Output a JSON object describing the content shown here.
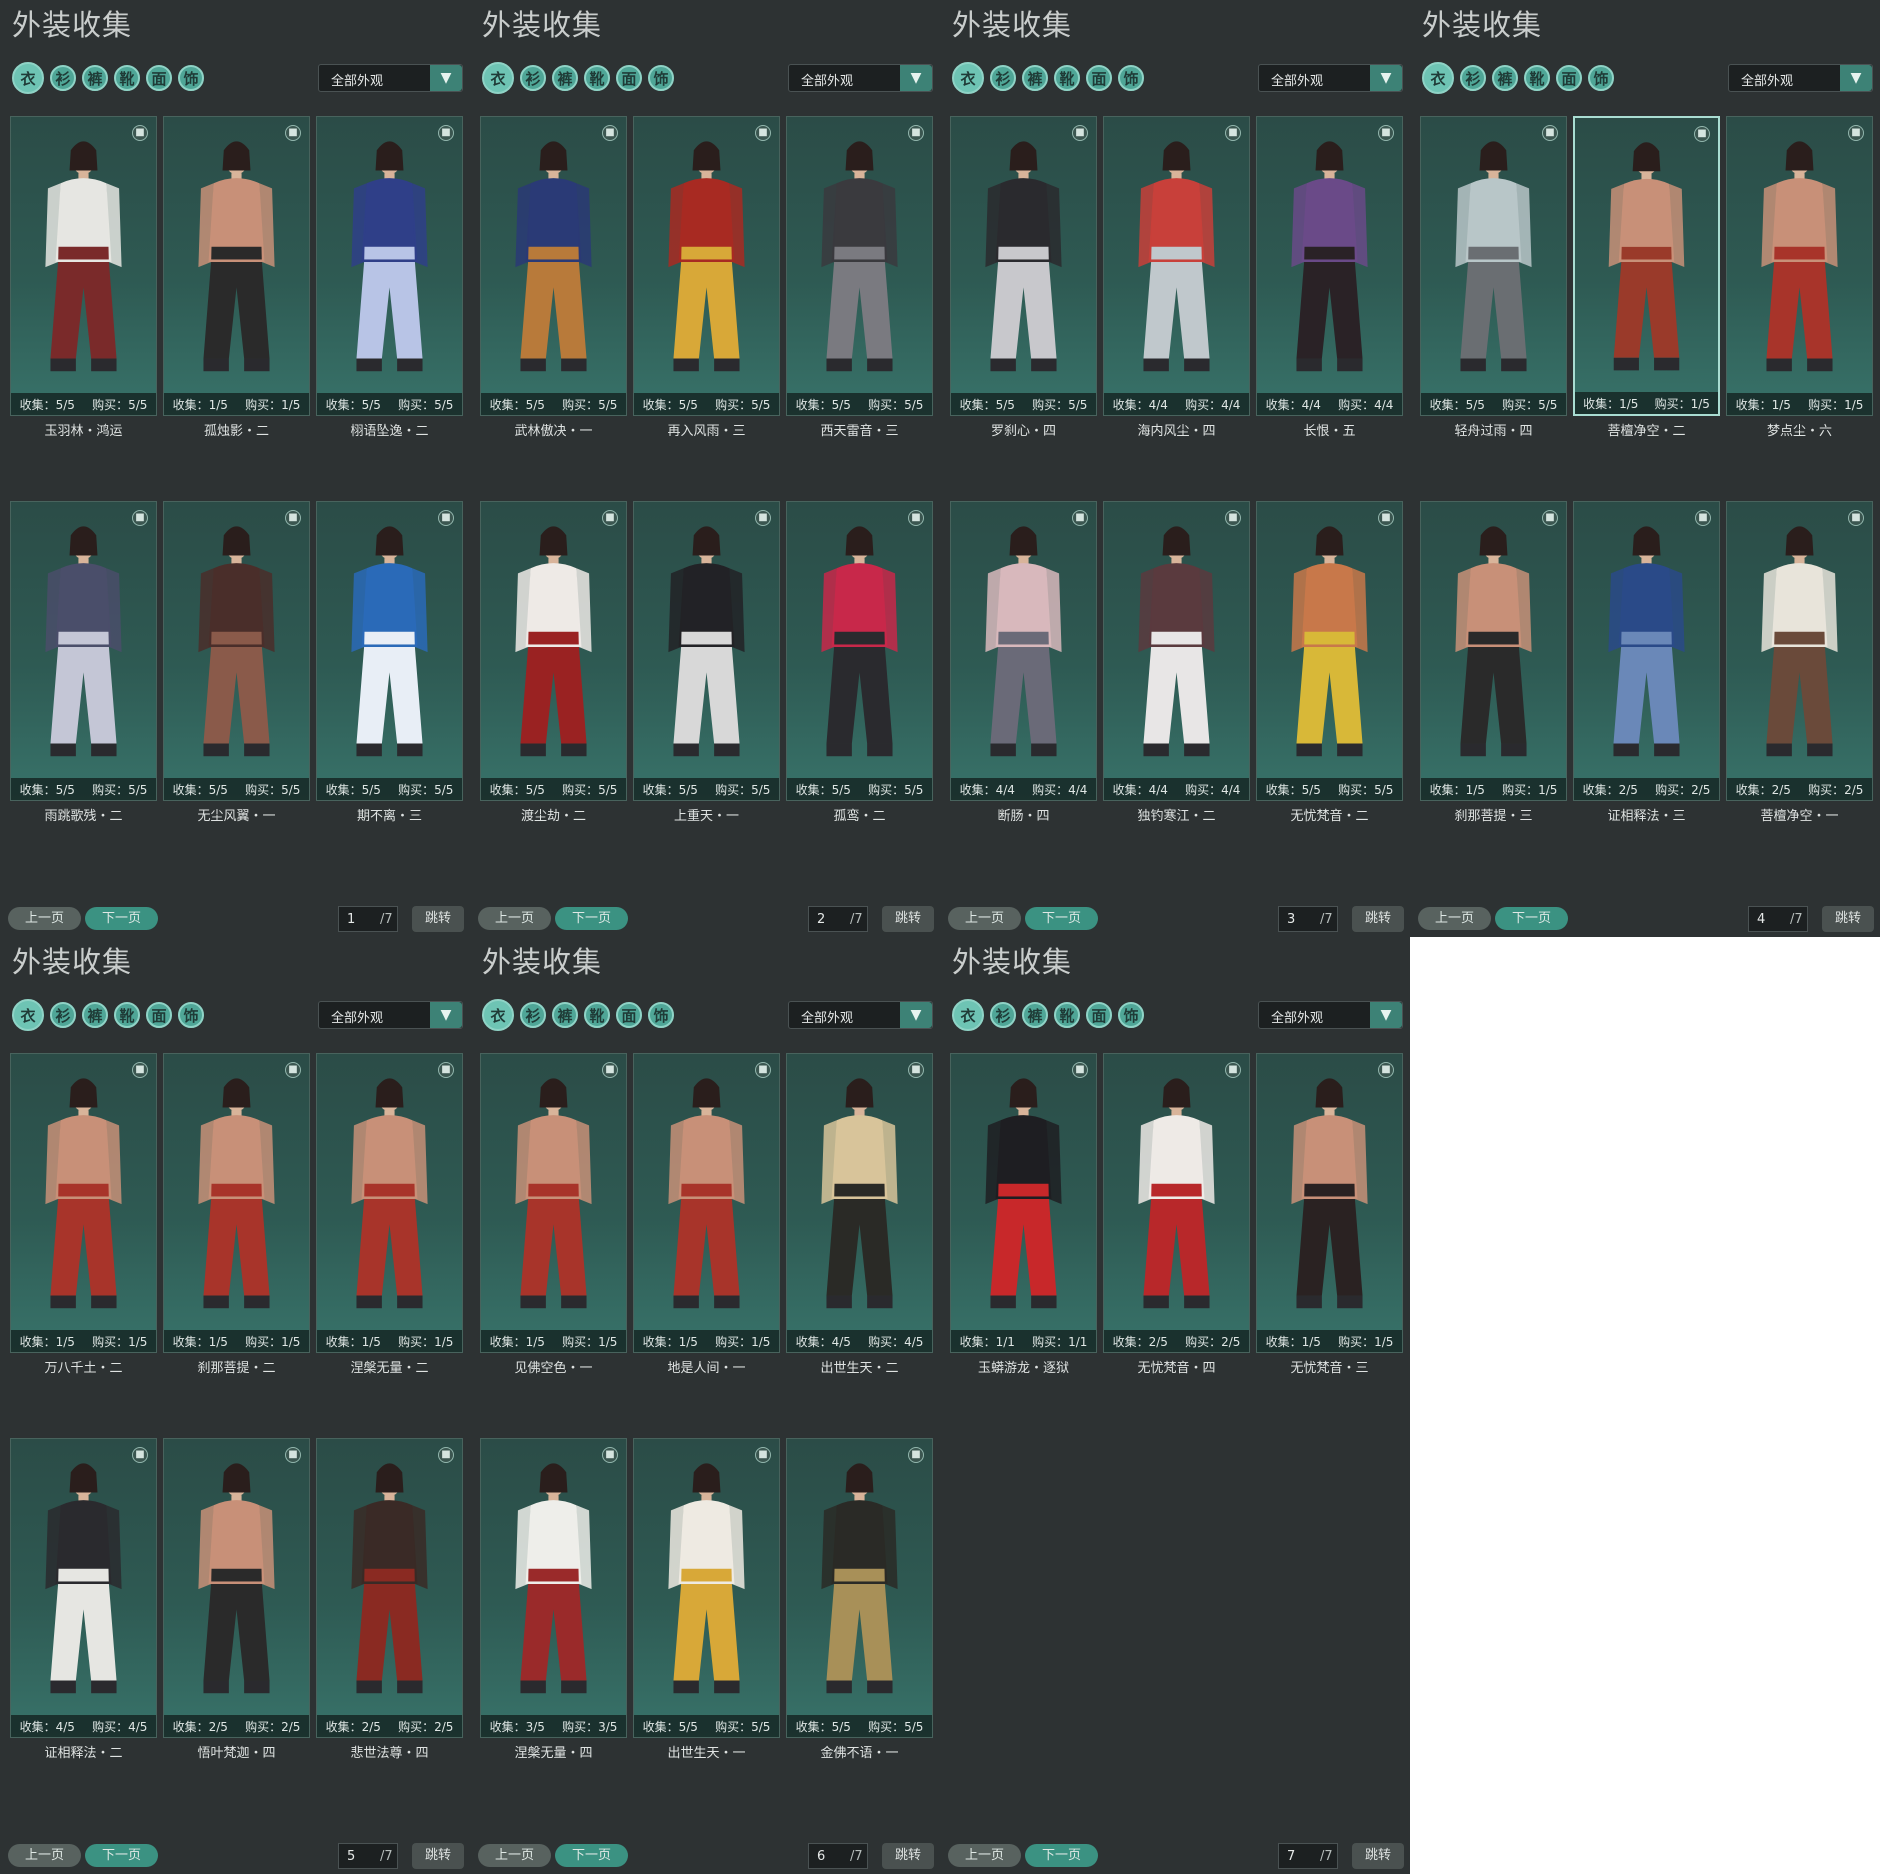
{
  "title": "外装收集",
  "filter_label": "全部外观",
  "prev_label": "上一页",
  "next_label": "下一页",
  "jump_label": "跳转",
  "collect_label": "收集",
  "buy_label": "购买",
  "colors": {
    "panel_bg": "#2d3233",
    "accent": "#3b9282",
    "card_top": "#2b4c47",
    "card_bottom": "#38736a"
  },
  "category_icons": [
    "all-outfits-icon",
    "top-icon",
    "bottom-icon",
    "shoes-icon",
    "mask-icon",
    "accessory-icon"
  ],
  "pages": [
    {
      "current": "1",
      "total": "/7",
      "items": [
        {
          "name": "玉羽林・鸿运",
          "collect": "5/5",
          "buy": "5/5",
          "colors": [
            "#e6e6e2",
            "#7a2a2a"
          ]
        },
        {
          "name": "孤烛影・二",
          "collect": "1/5",
          "buy": "1/5",
          "colors": [
            "#c89078",
            "#2a2a2a"
          ]
        },
        {
          "name": "栩语坠逸・二",
          "collect": "5/5",
          "buy": "5/5",
          "colors": [
            "#2f3f88",
            "#b8c4e6"
          ]
        },
        {
          "name": "雨跳歌残・二",
          "collect": "5/5",
          "buy": "5/5",
          "colors": [
            "#4a4e6a",
            "#c4c6d6"
          ]
        },
        {
          "name": "无尘风翼・一",
          "collect": "5/5",
          "buy": "5/5",
          "colors": [
            "#4a2e2a",
            "#8a5a4a"
          ]
        },
        {
          "name": "期不离・三",
          "collect": "5/5",
          "buy": "5/5",
          "colors": [
            "#2a6ab8",
            "#e8eef6"
          ]
        }
      ]
    },
    {
      "current": "2",
      "total": "/7",
      "items": [
        {
          "name": "武林傲决・一",
          "collect": "5/5",
          "buy": "5/5",
          "colors": [
            "#2a3a76",
            "#b87a3a"
          ]
        },
        {
          "name": "再入风雨・三",
          "collect": "5/5",
          "buy": "5/5",
          "colors": [
            "#a82a22",
            "#d8a838"
          ]
        },
        {
          "name": "西天雷音・三",
          "collect": "5/5",
          "buy": "5/5",
          "colors": [
            "#3a3a3e",
            "#7a7a80"
          ]
        },
        {
          "name": "渡尘劫・二",
          "collect": "5/5",
          "buy": "5/5",
          "colors": [
            "#eeeae6",
            "#9a2222"
          ]
        },
        {
          "name": "上重天・一",
          "collect": "5/5",
          "buy": "5/5",
          "colors": [
            "#222226",
            "#d8d8d8"
          ]
        },
        {
          "name": "孤鸾・二",
          "collect": "5/5",
          "buy": "5/5",
          "colors": [
            "#c8284a",
            "#2a2a2e"
          ]
        }
      ]
    },
    {
      "current": "3",
      "total": "/7",
      "items": [
        {
          "name": "罗刹心・四",
          "collect": "5/5",
          "buy": "5/5",
          "colors": [
            "#2a2a2e",
            "#c8c8cc"
          ]
        },
        {
          "name": "海内风尘・四",
          "collect": "4/4",
          "buy": "4/4",
          "colors": [
            "#c8403a",
            "#c0c8cc"
          ]
        },
        {
          "name": "长恨・五",
          "collect": "4/4",
          "buy": "4/4",
          "colors": [
            "#6a4a88",
            "#2a2226"
          ]
        },
        {
          "name": "断肠・四",
          "collect": "4/4",
          "buy": "4/4",
          "colors": [
            "#d8b8bc",
            "#6a6a78"
          ]
        },
        {
          "name": "独钓寒江・二",
          "collect": "4/4",
          "buy": "4/4",
          "colors": [
            "#5a3a3e",
            "#e8e6e6"
          ]
        },
        {
          "name": "无忧梵音・二",
          "collect": "5/5",
          "buy": "5/5",
          "colors": [
            "#c8784a",
            "#d8b838"
          ]
        }
      ]
    },
    {
      "current": "4",
      "total": "/7",
      "items": [
        {
          "name": "轻舟过雨・四",
          "collect": "5/5",
          "buy": "5/5",
          "colors": [
            "#b8c6c8",
            "#6a6e72"
          ],
          "selected": false
        },
        {
          "name": "菩檀净空・二",
          "collect": "1/5",
          "buy": "1/5",
          "colors": [
            "#c89078",
            "#9a3a2a"
          ],
          "selected": true
        },
        {
          "name": "梦点尘・六",
          "collect": "1/5",
          "buy": "1/5",
          "colors": [
            "#c89078",
            "#a8342a"
          ],
          "selected": false
        },
        {
          "name": "刹那菩提・三",
          "collect": "1/5",
          "buy": "1/5",
          "colors": [
            "#c89078",
            "#2a2a2a"
          ]
        },
        {
          "name": "证相释法・三",
          "collect": "2/5",
          "buy": "2/5",
          "colors": [
            "#2a4a88",
            "#6a88b8"
          ]
        },
        {
          "name": "菩檀净空・一",
          "collect": "2/5",
          "buy": "2/5",
          "colors": [
            "#e8e4da",
            "#6a4a3a"
          ]
        }
      ]
    },
    {
      "current": "5",
      "total": "/7",
      "items": [
        {
          "name": "万八千土・二",
          "collect": "1/5",
          "buy": "1/5",
          "colors": [
            "#c89078",
            "#a8342a"
          ]
        },
        {
          "name": "刹那菩提・二",
          "collect": "1/5",
          "buy": "1/5",
          "colors": [
            "#c89078",
            "#a8342a"
          ]
        },
        {
          "name": "涅槃无量・二",
          "collect": "1/5",
          "buy": "1/5",
          "colors": [
            "#c89078",
            "#a8342a"
          ]
        },
        {
          "name": "证相释法・二",
          "collect": "4/5",
          "buy": "4/5",
          "colors": [
            "#2a2a2e",
            "#e6e6e2"
          ]
        },
        {
          "name": "悟叶梵迦・四",
          "collect": "2/5",
          "buy": "2/5",
          "colors": [
            "#c89078",
            "#2a2a2a"
          ]
        },
        {
          "name": "悲世法尊・四",
          "collect": "2/5",
          "buy": "2/5",
          "colors": [
            "#3a2a26",
            "#8a2a22"
          ]
        }
      ]
    },
    {
      "current": "6",
      "total": "/7",
      "items": [
        {
          "name": "见佛空色・一",
          "collect": "1/5",
          "buy": "1/5",
          "colors": [
            "#c89078",
            "#a8342a"
          ]
        },
        {
          "name": "地是人间・一",
          "collect": "1/5",
          "buy": "1/5",
          "colors": [
            "#c89078",
            "#a8342a"
          ]
        },
        {
          "name": "出世生天・二",
          "collect": "4/5",
          "buy": "4/5",
          "colors": [
            "#d8c49a",
            "#2a2a26"
          ]
        },
        {
          "name": "涅槃无量・四",
          "collect": "3/5",
          "buy": "3/5",
          "colors": [
            "#eeeeea",
            "#9a2a2a"
          ]
        },
        {
          "name": "出世生天・一",
          "collect": "5/5",
          "buy": "5/5",
          "colors": [
            "#eeeae2",
            "#d8a838"
          ]
        },
        {
          "name": "金佛不语・一",
          "collect": "5/5",
          "buy": "5/5",
          "colors": [
            "#2a2a26",
            "#a89058"
          ]
        }
      ]
    },
    {
      "current": "7",
      "total": "/7",
      "items": [
        {
          "name": "玉蟒游龙・逐狱",
          "collect": "1/1",
          "buy": "1/1",
          "colors": [
            "#1e1e22",
            "#c8282a"
          ]
        },
        {
          "name": "无忧梵音・四",
          "collect": "2/5",
          "buy": "2/5",
          "colors": [
            "#eeeae6",
            "#b8282a"
          ]
        },
        {
          "name": "无忧梵音・三",
          "collect": "1/5",
          "buy": "1/5",
          "colors": [
            "#c89078",
            "#2a2222"
          ]
        }
      ]
    }
  ]
}
